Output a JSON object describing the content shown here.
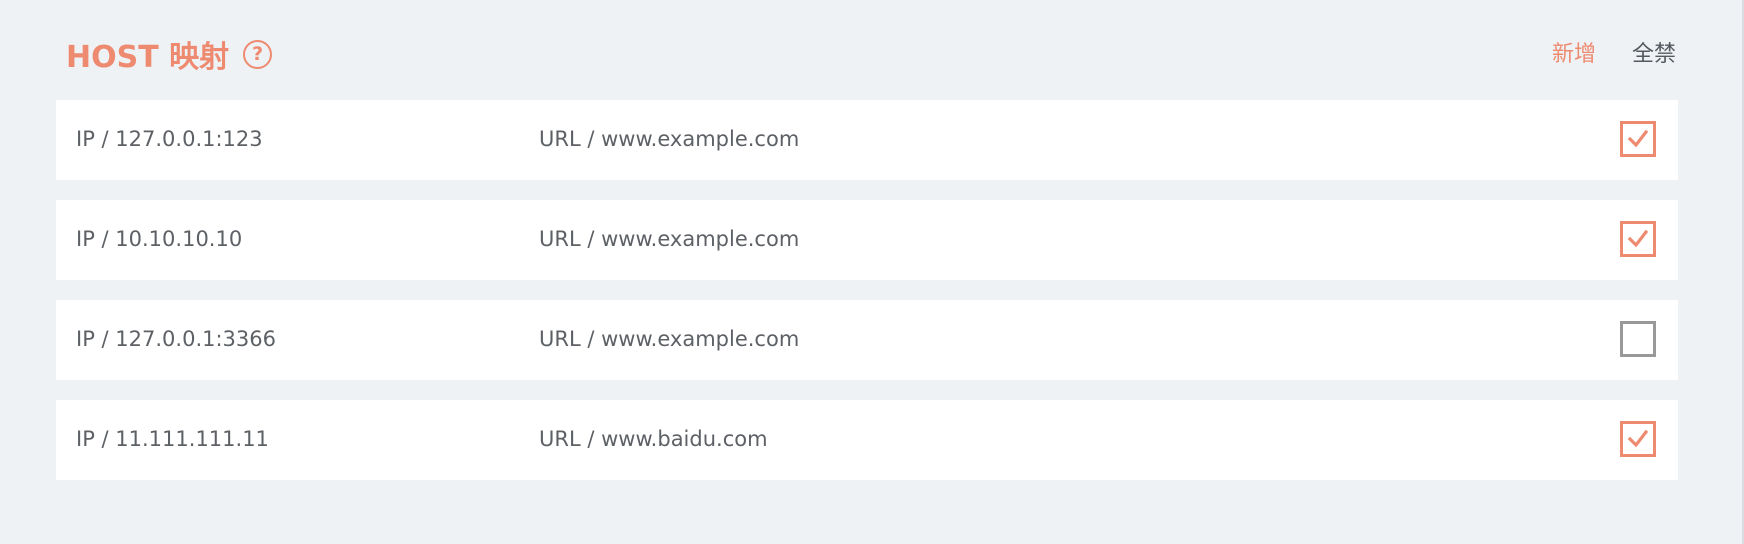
{
  "header": {
    "title": "HOST 映射",
    "help_icon": "?",
    "add_label": "新增",
    "disable_all_label": "全禁"
  },
  "colors": {
    "accent": "#ee8a70",
    "background": "#eef2f5",
    "row_background": "#ffffff",
    "text": "#5d6166",
    "checkbox_unchecked": "#999999"
  },
  "mappings": [
    {
      "ip": "IP / 127.0.0.1:123",
      "url": "URL / www.example.com",
      "enabled": true
    },
    {
      "ip": "IP / 10.10.10.10",
      "url": "URL / www.example.com",
      "enabled": true
    },
    {
      "ip": "IP / 127.0.0.1:3366",
      "url": "URL / www.example.com",
      "enabled": false
    },
    {
      "ip": "IP / 11.111.111.11",
      "url": "URL / www.baidu.com",
      "enabled": true
    }
  ]
}
